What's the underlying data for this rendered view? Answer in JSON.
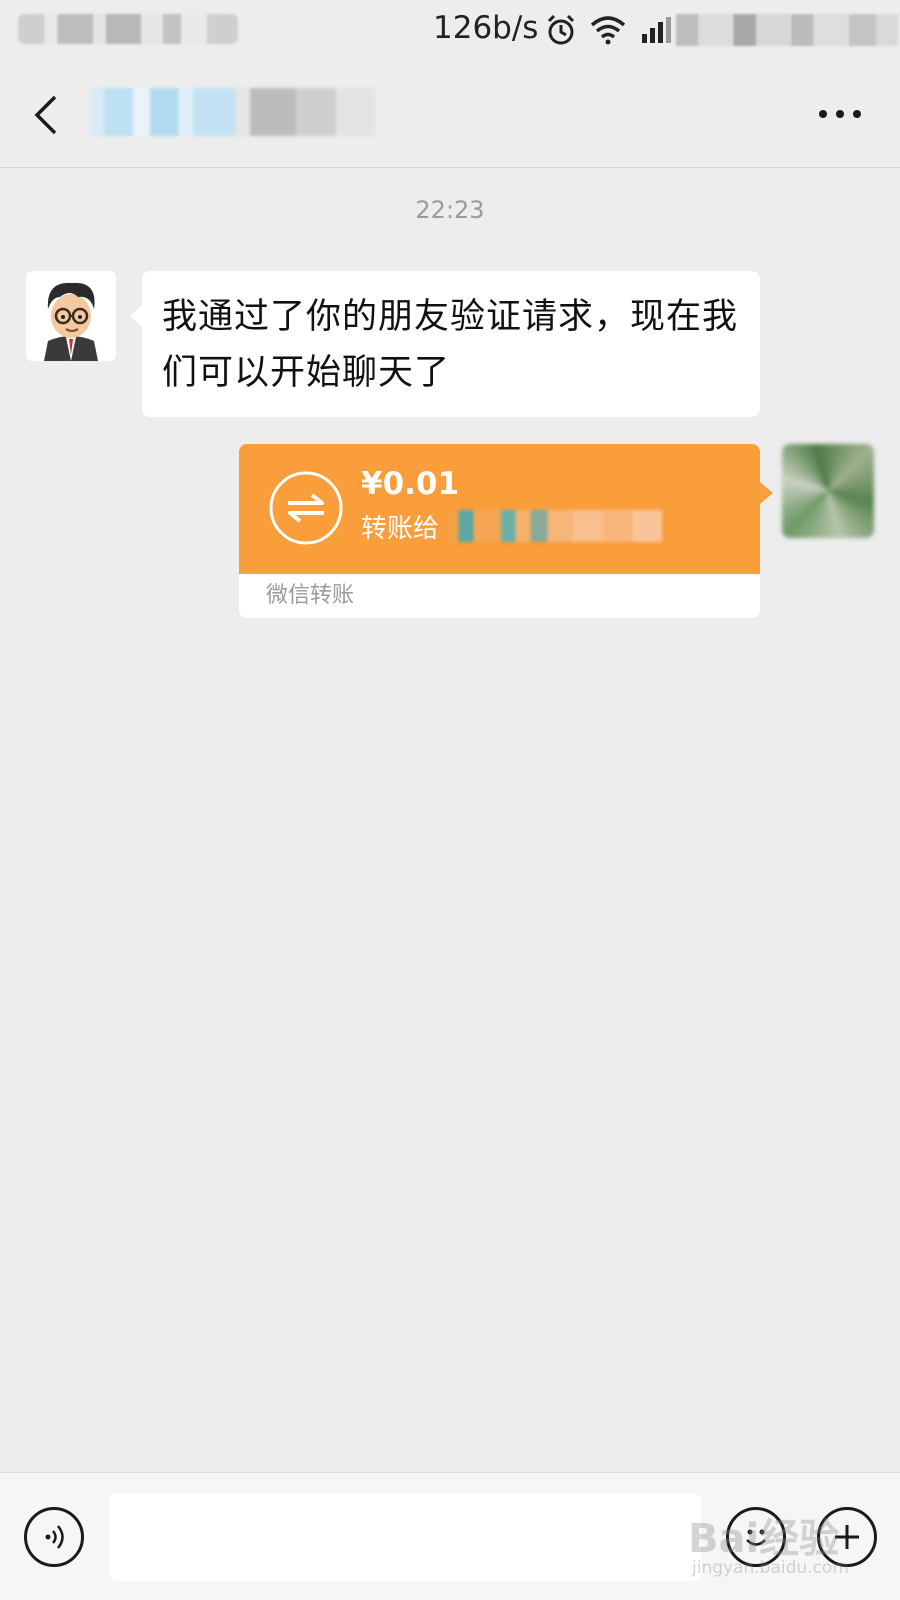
{
  "status_bar": {
    "net_speed": "126b/s",
    "icons": [
      "alarm-icon",
      "wifi-icon",
      "signal-icon"
    ]
  },
  "header": {
    "back_icon": "chevron-left-icon",
    "more_icon": "more-dots-icon"
  },
  "chat": {
    "timestamp": "22:23",
    "messages": [
      {
        "side": "left",
        "type": "text",
        "text": "我通过了你的朋友验证请求，现在我们可以开始聊天了"
      },
      {
        "side": "right",
        "type": "transfer",
        "amount": "¥0.01",
        "description": "转账给",
        "footer": "微信转账",
        "color": "#fa9d3b"
      }
    ]
  },
  "input_bar": {
    "voice_icon": "voice-icon",
    "emoji_icon": "emoji-icon",
    "plus_icon": "plus-icon",
    "text_value": ""
  },
  "watermark": {
    "text": "Bai经验",
    "sub": "jingyan.baidu.com"
  },
  "colors": {
    "background": "#ededed",
    "transfer_orange": "#fa9d3b",
    "bubble_white": "#ffffff"
  }
}
